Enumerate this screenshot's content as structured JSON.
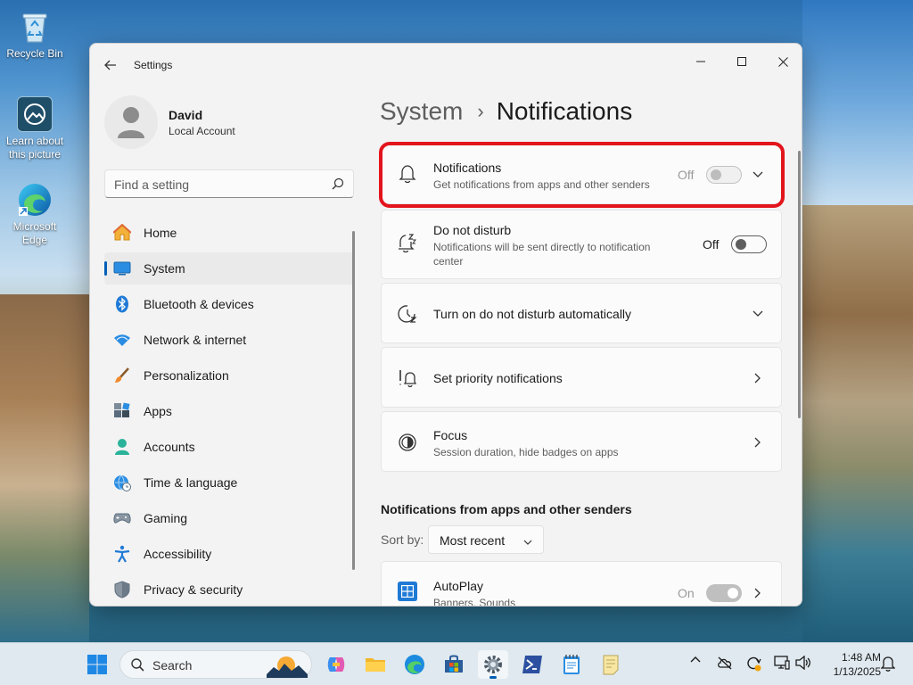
{
  "desktop": {
    "icons": [
      {
        "label": "Recycle Bin"
      },
      {
        "label": "Learn about this picture"
      },
      {
        "label": "Microsoft Edge"
      }
    ]
  },
  "window": {
    "title": "Settings",
    "controls": {
      "minimize": "—",
      "maximize": "☐",
      "close": "✕"
    }
  },
  "profile": {
    "name": "David",
    "account": "Local Account"
  },
  "search": {
    "placeholder": "Find a setting"
  },
  "nav": {
    "items": [
      {
        "label": "Home",
        "icon": "home-icon"
      },
      {
        "label": "System",
        "icon": "system-icon",
        "active": true
      },
      {
        "label": "Bluetooth & devices",
        "icon": "bluetooth-icon"
      },
      {
        "label": "Network & internet",
        "icon": "wifi-icon"
      },
      {
        "label": "Personalization",
        "icon": "brush-icon"
      },
      {
        "label": "Apps",
        "icon": "apps-icon"
      },
      {
        "label": "Accounts",
        "icon": "accounts-icon"
      },
      {
        "label": "Time & language",
        "icon": "globe-clock-icon"
      },
      {
        "label": "Gaming",
        "icon": "gamepad-icon"
      },
      {
        "label": "Accessibility",
        "icon": "accessibility-icon"
      },
      {
        "label": "Privacy & security",
        "icon": "shield-icon"
      }
    ]
  },
  "breadcrumb": {
    "parent": "System",
    "separator": "›",
    "current": "Notifications"
  },
  "cards": {
    "notifications": {
      "title": "Notifications",
      "subtitle": "Get notifications from apps and other senders",
      "state": "Off"
    },
    "dnd": {
      "title": "Do not disturb",
      "subtitle": "Notifications will be sent directly to notification center",
      "state": "Off"
    },
    "auto_dnd": {
      "title": "Turn on do not disturb automatically"
    },
    "priority": {
      "title": "Set priority notifications"
    },
    "focus": {
      "title": "Focus",
      "subtitle": "Session duration, hide badges on apps"
    },
    "autoplay": {
      "title": "AutoPlay",
      "subtitle": "Banners, Sounds",
      "state": "On"
    }
  },
  "senders": {
    "section_title": "Notifications from apps and other senders",
    "sort_label": "Sort by:",
    "sort_value": "Most recent"
  },
  "taskbar": {
    "search_placeholder": "Search",
    "time": "1:48 AM",
    "date": "1/13/2025"
  },
  "colors": {
    "accent": "#005fb8",
    "highlight": "#e3141c"
  }
}
